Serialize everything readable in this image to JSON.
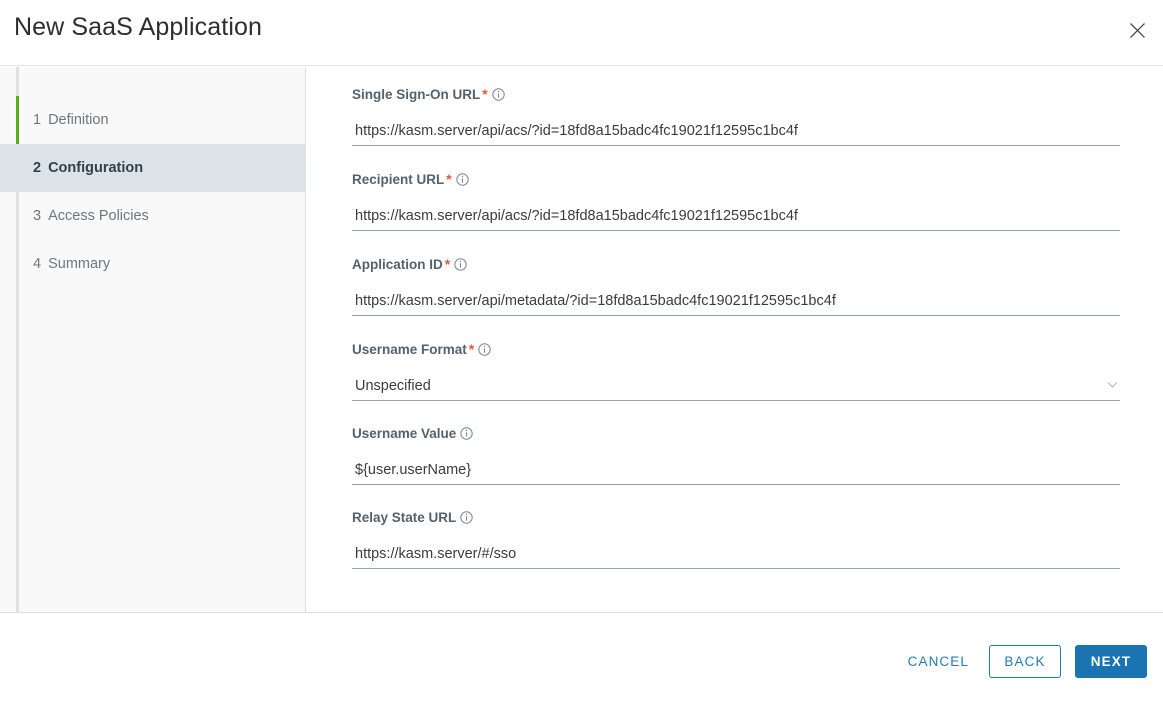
{
  "header": {
    "title": "New SaaS Application",
    "close_icon": "close-icon"
  },
  "sidebar": {
    "steps": [
      {
        "num": "1",
        "label": "Definition",
        "state": "done"
      },
      {
        "num": "2",
        "label": "Configuration",
        "state": "active"
      },
      {
        "num": "3",
        "label": "Access Policies",
        "state": "upcoming"
      },
      {
        "num": "4",
        "label": "Summary",
        "state": "upcoming"
      }
    ],
    "accent_done_color": "#5aab1f",
    "active_bg_color": "#dbe3e9"
  },
  "form": {
    "required_marker": "*",
    "info_icon": "info-circle-icon",
    "fields": [
      {
        "label": "Single Sign-On URL",
        "required": true,
        "type": "text",
        "value": "https://kasm.server/api/acs/?id=18fd8a15badc4fc19021f12595c1bc4f",
        "placeholder": ""
      },
      {
        "label": "Recipient URL",
        "required": true,
        "type": "text",
        "value": "https://kasm.server/api/acs/?id=18fd8a15badc4fc19021f12595c1bc4f",
        "placeholder": ""
      },
      {
        "label": "Application ID",
        "required": true,
        "type": "text",
        "value": "https://kasm.server/api/metadata/?id=18fd8a15badc4fc19021f12595c1bc4f",
        "placeholder": ""
      },
      {
        "label": "Username Format",
        "required": true,
        "type": "select",
        "value": "Unspecified",
        "placeholder": ""
      },
      {
        "label": "Username Value",
        "required": false,
        "type": "text",
        "value": "${user.userName}",
        "placeholder": ""
      },
      {
        "label": "Relay State URL",
        "required": false,
        "type": "text",
        "value": "https://kasm.server/#/sso",
        "placeholder": ""
      }
    ]
  },
  "footer": {
    "cancel_label": "CANCEL",
    "back_label": "BACK",
    "next_label": "NEXT",
    "primary_color": "#1b74b2",
    "link_color": "#1f7cb8"
  }
}
